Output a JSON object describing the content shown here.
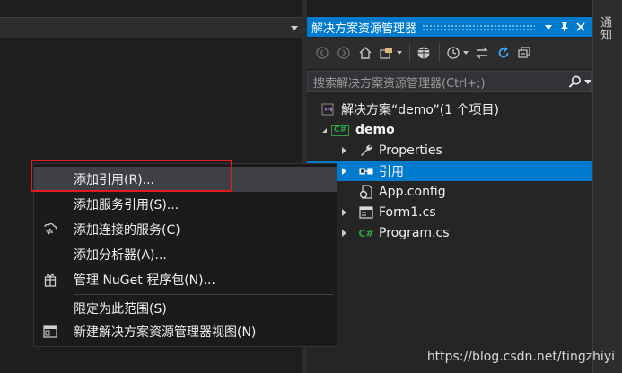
{
  "colors": {
    "accent": "#007acc",
    "highlight_box": "#e51c1c",
    "cs_green": "#2ea043",
    "vs_purple": "#a074c4"
  },
  "solution_explorer": {
    "title": "解决方案资源管理器",
    "search_placeholder": "搜索解决方案资源管理器(Ctrl+;)",
    "tree": {
      "solution": "解决方案“demo”(1 个项目)",
      "project": "demo",
      "project_badge": "C#",
      "items": [
        "Properties",
        "引用",
        "App.config",
        "Form1.cs",
        "Program.cs"
      ],
      "selected_item": "引用",
      "program_icon": "C#"
    }
  },
  "notifications_tab": "通知",
  "context_menu": {
    "items": [
      "添加引用(R)...",
      "添加服务引用(S)...",
      "添加连接的服务(C)",
      "添加分析器(A)...",
      "管理 NuGet 程序包(N)...",
      "限定为此范围(S)",
      "新建解决方案资源管理器视图(N)"
    ],
    "highlighted_item": "添加引用(R)..."
  },
  "watermark": "https://blog.csdn.net/tingzhiyi"
}
